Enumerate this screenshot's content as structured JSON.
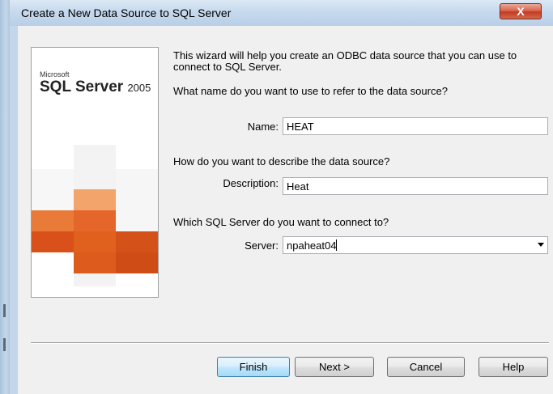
{
  "window": {
    "title": "Create a New Data Source to SQL Server",
    "close_glyph": "X"
  },
  "banner": {
    "brand_small": "Microsoft",
    "product": "SQL Server",
    "version": "2005",
    "accent": "#e8601c"
  },
  "intro": {
    "line1": "This wizard will help you create an ODBC data source that you can use to",
    "line2": "connect to SQL Server."
  },
  "name_section": {
    "question": "What name do you want to use to refer to the data source?",
    "label": "Name:",
    "value": "HEAT"
  },
  "description_section": {
    "question": "How do you want to describe the data source?",
    "label": "Description:",
    "value": "Heat"
  },
  "server_section": {
    "question": "Which SQL Server do you want to connect to?",
    "label": "Server:",
    "value": "npaheat04",
    "dropdown_icon": "chevron-down-icon"
  },
  "buttons": {
    "finish": "Finish",
    "next": "Next >",
    "cancel": "Cancel",
    "help": "Help"
  }
}
